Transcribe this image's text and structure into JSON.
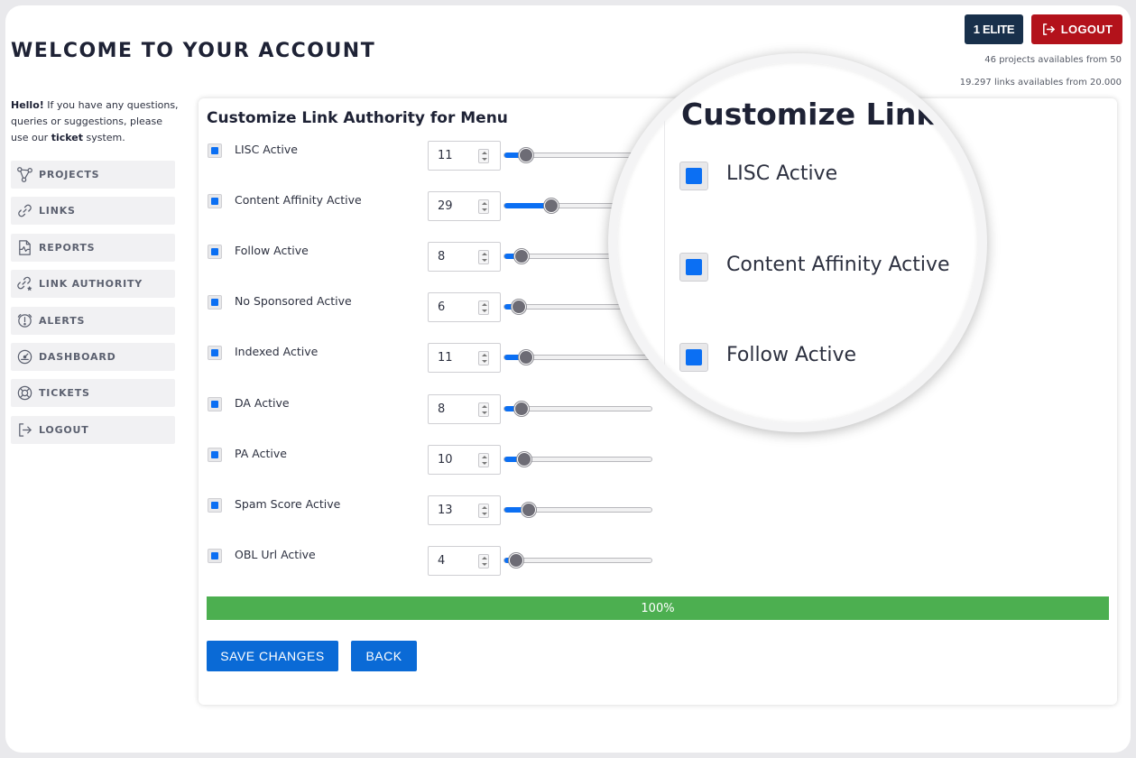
{
  "header": {
    "page_title": "WELCOME TO YOUR ACCOUNT",
    "plan_label": "1 ELITE",
    "logout_label": "LOGOUT",
    "projects_quota": "46 projects availables from 50",
    "links_quota": "19.297 links availables from 20.000"
  },
  "intro": {
    "hello": "Hello!",
    "text_before_link": " If you have any questions, queries or suggestions, please use our ",
    "ticket_link": "ticket",
    "text_after_link": " system."
  },
  "sidebar": {
    "items": [
      {
        "label": "PROJECTS",
        "icon": "projects-icon"
      },
      {
        "label": "LINKS",
        "icon": "link-icon"
      },
      {
        "label": "REPORTS",
        "icon": "report-icon"
      },
      {
        "label": "LINK AUTHORITY",
        "icon": "link-authority-icon"
      },
      {
        "label": "ALERTS",
        "icon": "alert-icon"
      },
      {
        "label": "DASHBOARD",
        "icon": "dashboard-icon"
      },
      {
        "label": "TICKETS",
        "icon": "lifebuoy-icon"
      },
      {
        "label": "LOGOUT",
        "icon": "logout-icon"
      }
    ]
  },
  "form": {
    "title": "Customize Link Authority for Menu",
    "slider_min": 0,
    "slider_max": 100,
    "rows": [
      {
        "label": "LISC Active",
        "checked": true,
        "value": "11"
      },
      {
        "label": "Content Affinity Active",
        "checked": true,
        "value": "29"
      },
      {
        "label": "Follow Active",
        "checked": true,
        "value": "8"
      },
      {
        "label": "No Sponsored Active",
        "checked": true,
        "value": "6"
      },
      {
        "label": "Indexed Active",
        "checked": true,
        "value": "11"
      },
      {
        "label": "DA Active",
        "checked": true,
        "value": "8"
      },
      {
        "label": "PA Active",
        "checked": true,
        "value": "10"
      },
      {
        "label": "Spam Score Active",
        "checked": true,
        "value": "13"
      },
      {
        "label": "OBL Url Active",
        "checked": true,
        "value": "4"
      }
    ],
    "progress_label": "100%",
    "progress_value": 100,
    "save_label": "SAVE CHANGES",
    "back_label": "BACK"
  },
  "magnifier": {
    "title": "Customize Link Au",
    "rows": [
      "LISC Active",
      "Content Affinity Active",
      "Follow Active"
    ]
  },
  "colors": {
    "accent": "#0b6ff3",
    "button": "#0a6ad6",
    "plan_bg": "#18304b",
    "logout_bg": "#b3121b",
    "progress": "#4caf50"
  }
}
